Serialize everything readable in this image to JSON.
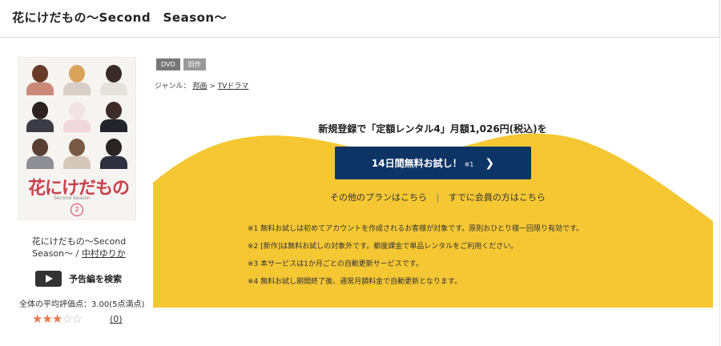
{
  "page_title": "花にけだもの〜Second　Season〜",
  "jacket": {
    "logo": "花にけだもの",
    "subtitle": "Second Season",
    "volume": "2"
  },
  "item": {
    "title": "花にけだもの〜Second　Season〜",
    "separator": " / ",
    "author": "中村ゆりか"
  },
  "trailer": {
    "label": "予告編を検索"
  },
  "rating": {
    "average_text": "全体の平均評価点：3.00(5点満点)",
    "score": 3,
    "max": 5,
    "review_count": "(0)"
  },
  "badges": [
    "DVD",
    "旧作"
  ],
  "genre": {
    "label": "ジャンル：",
    "crumbs": [
      "邦画",
      "TVドラマ"
    ],
    "separator": ">"
  },
  "promo": {
    "headline": "新規登録で「定額レンタル4」月額1,026円(税込)を",
    "cta_label": "14日間無料お試し！",
    "cta_note": "※1",
    "link_other_plans": "その他のプランはこちら",
    "link_separator": "|",
    "link_member": "すでに会員の方はこちら",
    "notes": [
      "※1 無料お試しは初めてアカウントを作成されるお客様が対象です。原則おひとり様一回限り有効です。",
      "※2 [新作]は無料お試しの対象外です。都度課金で単品レンタルをご利用ください。",
      "※3 本サービスは1か月ごとの自動更新サービスです。",
      "※4 無料お試し期間終了後、通常月額料金で自動更新となります。"
    ],
    "colors": {
      "band": "#f5c733",
      "button": "#0e3466"
    }
  }
}
